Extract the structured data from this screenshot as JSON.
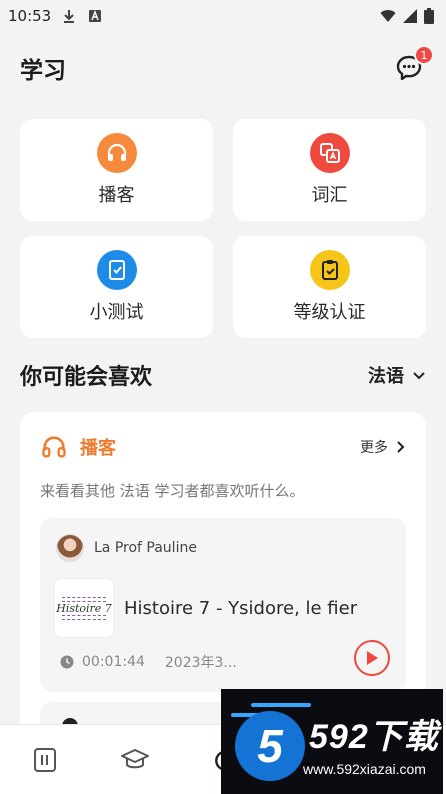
{
  "status_bar": {
    "time": "10:53"
  },
  "header": {
    "title": "学习",
    "message_badge": "1"
  },
  "tiles": [
    {
      "label": "播客",
      "color": "#f58a3c",
      "icon": "headphones-icon"
    },
    {
      "label": "词汇",
      "color": "#ef4a3d",
      "icon": "vocabulary-icon"
    },
    {
      "label": "小测试",
      "color": "#1e8be6",
      "icon": "quiz-icon"
    },
    {
      "label": "等级认证",
      "color": "#f5c518",
      "icon": "clipboard-check-icon"
    }
  ],
  "recommend": {
    "title": "你可能会喜欢",
    "language": "法语"
  },
  "podcast_card": {
    "title": "播客",
    "more": "更多",
    "description": "来看看其他 法语 学习者都喜欢听什么。",
    "episode": {
      "author": "La Prof Pauline",
      "thumb_text": "Histoire 7",
      "title": "Histoire 7 - Ysidore, le fier",
      "duration": "00:01:44",
      "date": "2023年3..."
    }
  },
  "watermark": {
    "brand": "592下载",
    "url": "www.592xiazai.com",
    "digit": "5"
  },
  "colors": {
    "accent_orange": "#f07a2e",
    "play_red": "#ef4a3d",
    "background": "#f3f3f4"
  }
}
